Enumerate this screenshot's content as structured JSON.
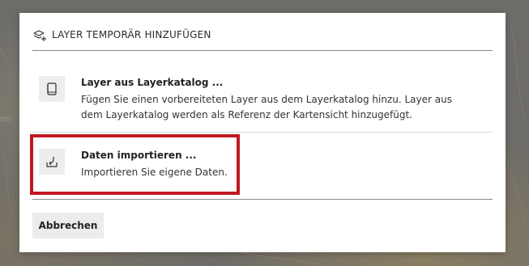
{
  "dialog": {
    "title": "LAYER TEMPORÄR HINZUFÜGEN",
    "title_icon": "layers-add-icon",
    "options": [
      {
        "icon": "book-icon",
        "title": "Layer aus Layerkatalog ...",
        "description": "Fügen Sie einen vorbereiteten Layer aus dem Layerkatalog hinzu. Layer aus dem Layerkatalog werden als Referenz der Kartensicht hinzugefügt."
      },
      {
        "icon": "import-icon",
        "title": "Daten importieren ...",
        "description": "Importieren Sie eigene Daten."
      }
    ],
    "cancel_label": "Abbrechen"
  },
  "background": {
    "edge_text": "en"
  },
  "colors": {
    "highlight": "#c0191f",
    "overlay": "#6e6c68",
    "icon_bg": "#ededed"
  }
}
